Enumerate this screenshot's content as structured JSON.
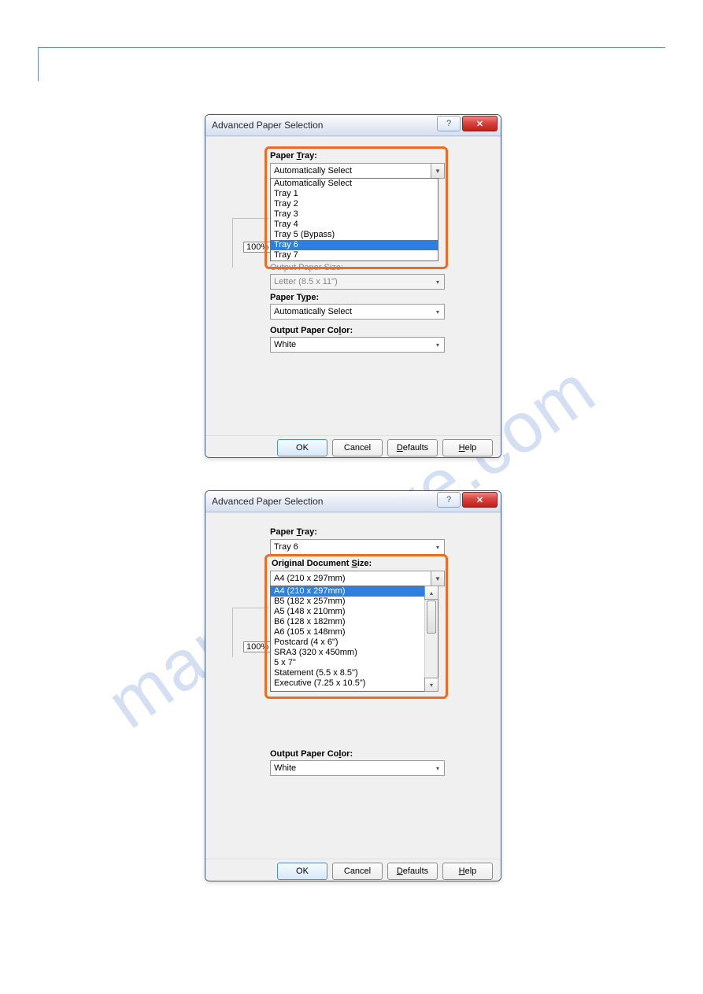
{
  "watermark": "manualshive.com",
  "dialog1": {
    "title": "Advanced Paper Selection",
    "paper_tray_label": "Paper Tray:",
    "paper_tray_selected": "Automatically Select",
    "paper_tray_options": [
      "Automatically Select",
      "Tray 1",
      "Tray 2",
      "Tray 3",
      "Tray 4",
      "Tray 5 (Bypass)",
      "Tray 6",
      "Tray 7"
    ],
    "zoom": "100%",
    "output_paper_size_label": "Output Paper Size:",
    "output_paper_size": "Letter (8.5 x 11\")",
    "paper_type_label": "Paper Type:",
    "paper_type": "Automatically Select",
    "output_paper_color_label": "Output Paper Color:",
    "output_paper_color": "White",
    "selected_option_index": 6,
    "buttons": {
      "ok": "OK",
      "cancel": "Cancel",
      "defaults": "Defaults",
      "help": "Help"
    }
  },
  "dialog2": {
    "title": "Advanced Paper Selection",
    "paper_tray_label": "Paper Tray:",
    "paper_tray_selected": "Tray 6",
    "original_doc_size_label": "Original Document Size:",
    "original_doc_size_selected": "A4 (210 x 297mm)",
    "original_doc_size_options": [
      "A4 (210 x 297mm)",
      "B5 (182 x 257mm)",
      "A5 (148 x 210mm)",
      "B6 (128 x 182mm)",
      "A6 (105 x 148mm)",
      "Postcard (4 x 6\")",
      "SRA3 (320 x 450mm)",
      "5 x 7\"",
      "Statement (5.5 x 8.5\")",
      "Executive (7.25 x 10.5\")"
    ],
    "zoom": "100%",
    "output_paper_color_label": "Output Paper Color:",
    "output_paper_color": "White",
    "selected_option_index": 0,
    "buttons": {
      "ok": "OK",
      "cancel": "Cancel",
      "defaults": "Defaults",
      "help": "Help"
    }
  }
}
